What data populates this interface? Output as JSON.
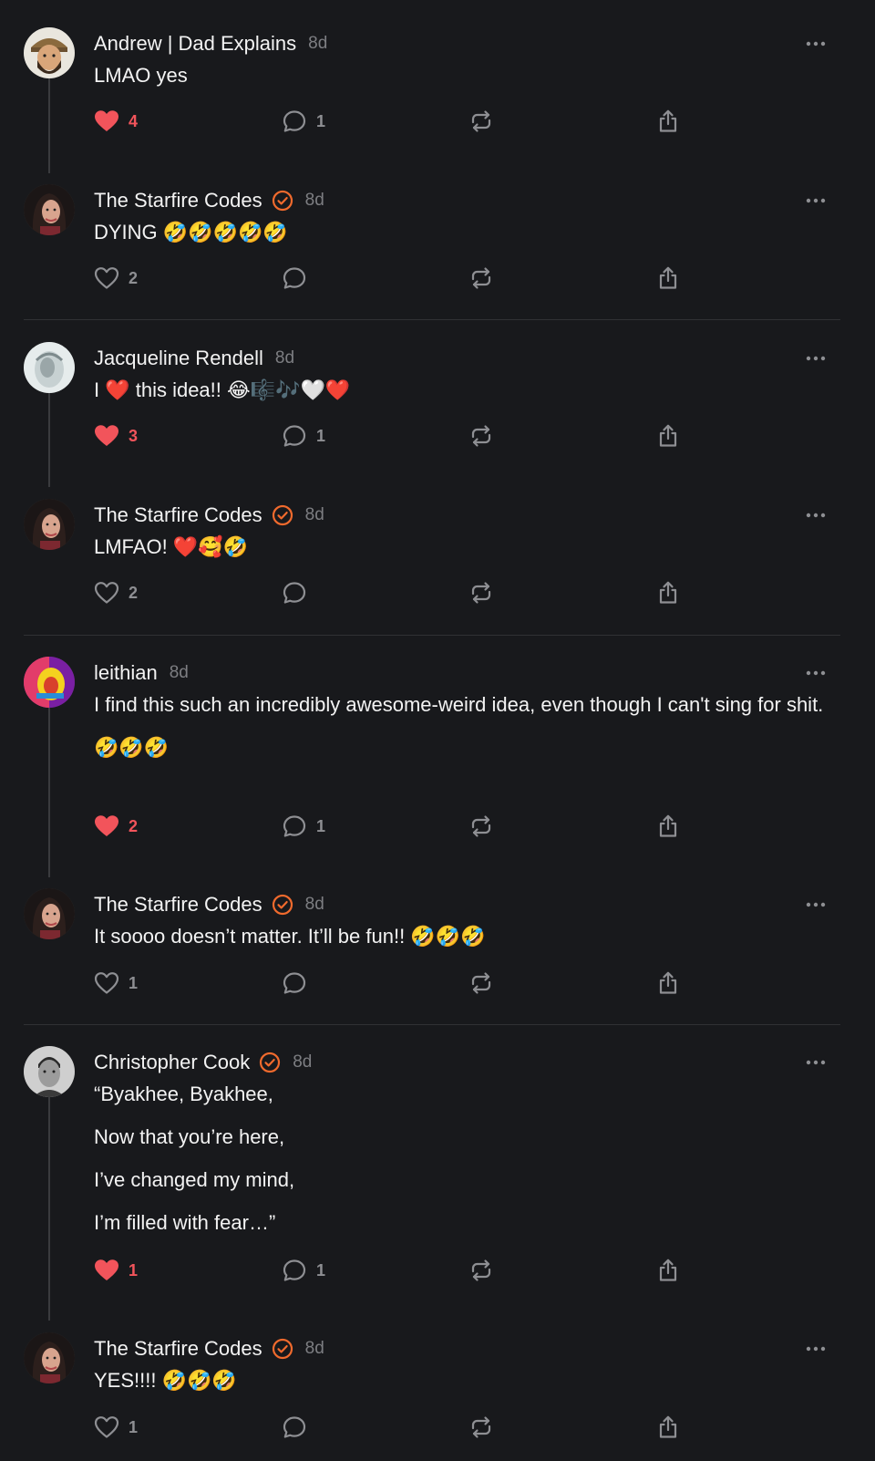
{
  "colors": {
    "background": "#18191c",
    "text": "#f3f3f3",
    "muted": "#7d7e82",
    "like_active": "#f2545b",
    "verified": "#f06a2d",
    "thread_line": "#3a3b3e",
    "divider": "#303134"
  },
  "posts": [
    {
      "username": "Andrew | Dad Explains",
      "verified": false,
      "time": "8d",
      "lines": [
        "LMAO yes"
      ],
      "likes": "4",
      "liked": true,
      "replies": "1",
      "avatar": "avatar-andrew",
      "avatar_icon": "cartoon-bearded-man-avatar"
    },
    {
      "username": "The Starfire Codes",
      "verified": true,
      "time": "8d",
      "lines": [
        "DYING 🤣🤣🤣🤣🤣"
      ],
      "likes": "2",
      "liked": false,
      "replies": "",
      "avatar": "avatar-starfire",
      "avatar_icon": "dark-haired-woman-avatar"
    },
    {
      "username": "Jacqueline Rendell",
      "verified": false,
      "time": "8d",
      "lines": [
        "I ❤️ this idea!! 😂🎼🎶🤍❤️"
      ],
      "likes": "3",
      "liked": true,
      "replies": "1",
      "avatar": "avatar-jacqueline",
      "avatar_icon": "light-grey-portrait-avatar"
    },
    {
      "username": "The Starfire Codes",
      "verified": true,
      "time": "8d",
      "lines": [
        "LMFAO! ❤️🥰🤣"
      ],
      "likes": "2",
      "liked": false,
      "replies": "",
      "avatar": "avatar-starfire",
      "avatar_icon": "dark-haired-woman-avatar"
    },
    {
      "username": "leithian",
      "verified": false,
      "time": "8d",
      "lines": [
        "I find this such an incredibly awesome-weird idea, even though I can't sing for shit.",
        "🤣🤣🤣"
      ],
      "likes": "2",
      "liked": true,
      "replies": "1",
      "avatar": "avatar-leithian",
      "avatar_icon": "colorful-pop-art-avatar"
    },
    {
      "username": "The Starfire Codes",
      "verified": true,
      "time": "8d",
      "lines": [
        "It soooo doesn’t matter. It’ll be fun!! 🤣🤣🤣"
      ],
      "likes": "1",
      "liked": false,
      "replies": "",
      "avatar": "avatar-starfire",
      "avatar_icon": "dark-haired-woman-avatar"
    },
    {
      "username": "Christopher Cook",
      "verified": true,
      "time": "8d",
      "lines": [
        "“Byakhee, Byakhee,",
        "Now that you’re here,",
        "I’ve changed my mind,",
        "I’m filled with fear…”"
      ],
      "likes": "1",
      "liked": true,
      "replies": "1",
      "avatar": "avatar-christopher",
      "avatar_icon": "black-and-white-man-portrait-avatar"
    },
    {
      "username": "The Starfire Codes",
      "verified": true,
      "time": "8d",
      "lines": [
        "YES!!!! 🤣🤣🤣"
      ],
      "likes": "1",
      "liked": false,
      "replies": "",
      "avatar": "avatar-starfire",
      "avatar_icon": "dark-haired-woman-avatar"
    }
  ]
}
